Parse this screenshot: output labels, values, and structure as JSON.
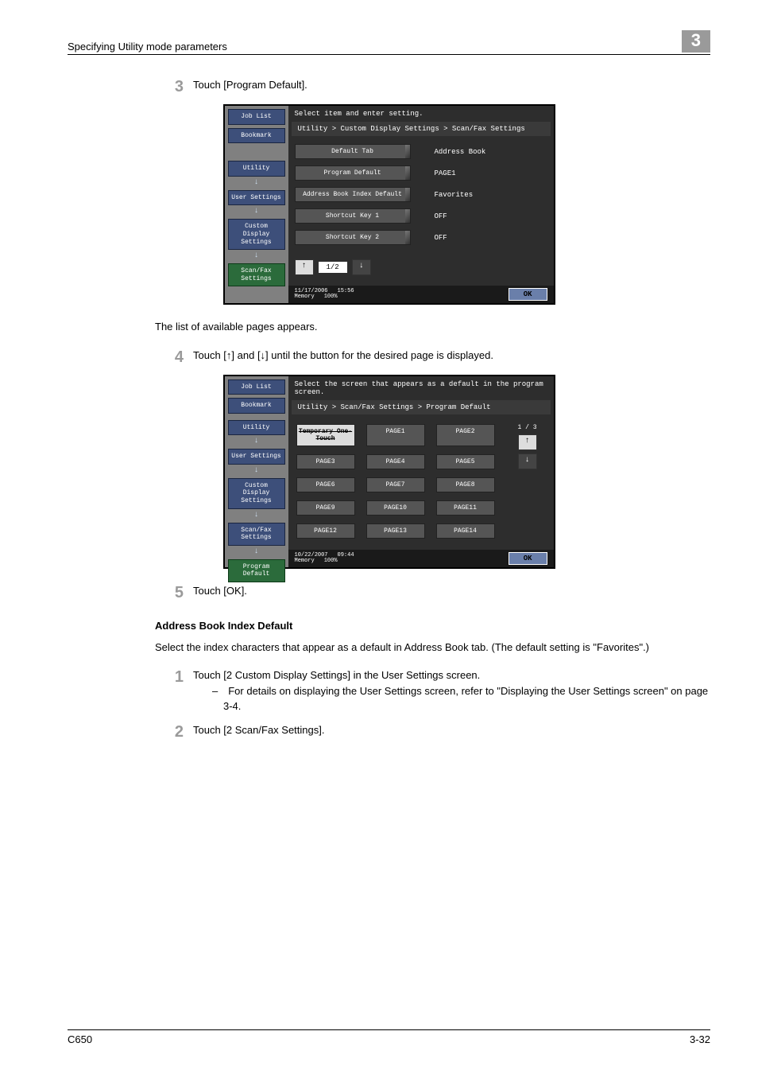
{
  "header": {
    "title": "Specifying Utility mode parameters",
    "chapter": "3"
  },
  "steps": {
    "s3": {
      "num": "3",
      "text": "Touch [Program Default]."
    },
    "s3_after": "The list of available pages appears.",
    "s4": {
      "num": "4",
      "text": "Touch [↑] and [↓] until the button for the desired page is displayed."
    },
    "s5": {
      "num": "5",
      "text": "Touch [OK]."
    },
    "n1": {
      "num": "1",
      "text": "Touch [2 Custom Display Settings] in the User Settings screen.",
      "sub": "– For details on displaying the User Settings screen, refer to \"Displaying the User Settings screen\" on page 3-4."
    },
    "n2": {
      "num": "2",
      "text": "Touch [2 Scan/Fax Settings]."
    }
  },
  "section": {
    "heading": "Address Book Index Default",
    "intro": "Select the index characters that appear as a default in Address Book tab. (The default setting is \"Favorites\".)"
  },
  "shot1": {
    "side": {
      "jobList": "Job List",
      "bookmark": "Bookmark",
      "utility": "Utility",
      "userSettings": "User Settings",
      "custom": "Custom Display Settings",
      "scanfax": "Scan/Fax Settings"
    },
    "msg": "Select item and enter setting.",
    "crumb": "Utility > Custom Display Settings > Scan/Fax Settings",
    "rows": {
      "r1": {
        "label": "Default Tab",
        "val": "Address Book"
      },
      "r2": {
        "label": "Program Default",
        "val": "PAGE1"
      },
      "r3": {
        "label": "Address Book Index Default",
        "val": "Favorites"
      },
      "r4": {
        "label": "Shortcut Key 1",
        "val": "OFF"
      },
      "r5": {
        "label": "Shortcut Key 2",
        "val": "OFF"
      }
    },
    "pager": "1/2",
    "status": {
      "date": "11/17/2006",
      "time": "15:56",
      "mem": "Memory",
      "pct": "100%"
    },
    "ok": "OK"
  },
  "shot2": {
    "side": {
      "jobList": "Job List",
      "bookmark": "Bookmark",
      "utility": "Utility",
      "userSettings": "User Settings",
      "custom": "Custom Display Settings",
      "scanfax": "Scan/Fax Settings",
      "prog": "Program Default"
    },
    "msg": "Select the screen that appears as a default in the program screen.",
    "crumb": "Utility > Scan/Fax Settings > Program Default",
    "cells": {
      "c0": "Temporary One-Touch",
      "c1": "PAGE1",
      "c2": "PAGE2",
      "c3": "PAGE3",
      "c4": "PAGE4",
      "c5": "PAGE5",
      "c6": "PAGE6",
      "c7": "PAGE7",
      "c8": "PAGE8",
      "c9": "PAGE9",
      "c10": "PAGE10",
      "c11": "PAGE11",
      "c12": "PAGE12",
      "c13": "PAGE13",
      "c14": "PAGE14"
    },
    "page": "1 / 3",
    "status": {
      "date": "10/22/2007",
      "time": "09:44",
      "mem": "Memory",
      "pct": "100%"
    },
    "ok": "OK"
  },
  "footer": {
    "left": "C650",
    "right": "3-32"
  }
}
